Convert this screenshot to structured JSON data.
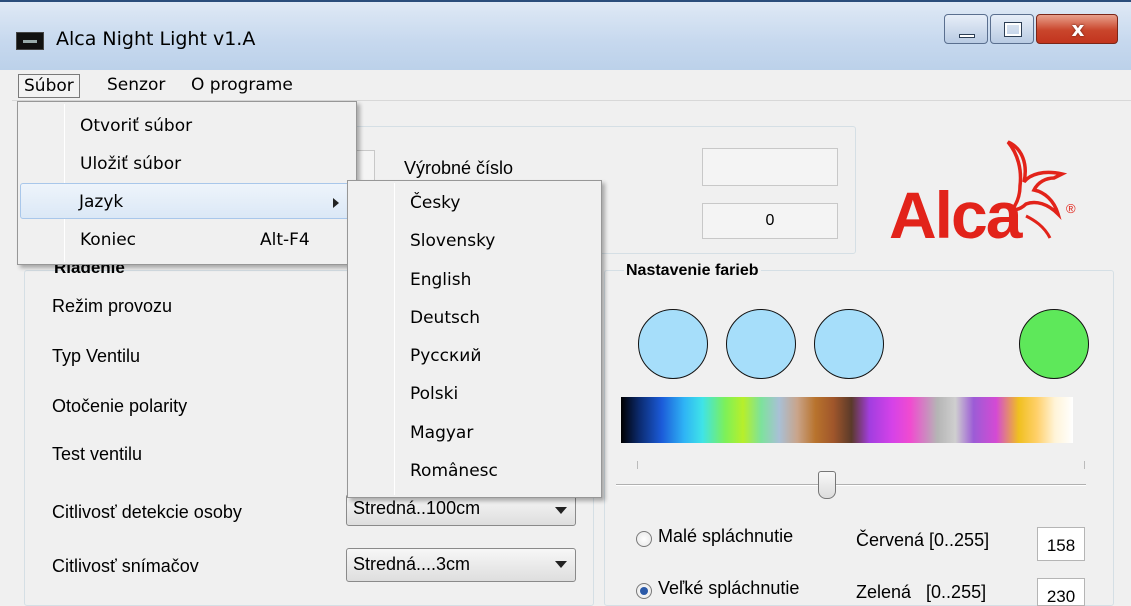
{
  "window": {
    "title": "Alca Night Light  v1.A",
    "close_glyph": "x"
  },
  "menubar": {
    "items": [
      "Súbor",
      "Senzor",
      "O programe"
    ]
  },
  "file_menu": {
    "items": [
      {
        "label": "Otvoriť súbor",
        "shortcut": ""
      },
      {
        "label": "Uložiť súbor",
        "shortcut": ""
      },
      {
        "label": "Jazyk",
        "shortcut": ""
      },
      {
        "label": "Koniec",
        "shortcut": "Alt-F4"
      }
    ]
  },
  "language_menu": {
    "items": [
      "Česky",
      "Slovensky",
      "English",
      "Deutsch",
      "Русский",
      "Polski",
      "Magyar",
      "Românesc"
    ]
  },
  "device": {
    "serial_label": "Výrobné číslo",
    "serial_value": "",
    "count_value": "0"
  },
  "logo": {
    "text": "Alca",
    "reg": "®"
  },
  "control": {
    "title": "Riadenie",
    "rows": [
      "Režim provozu",
      "Typ Ventilu",
      "Otočenie polarity",
      "Test ventilu",
      "Citlivosť detekcie osoby",
      "Citlivosť snímačov"
    ],
    "detection_value": "Stredná..100cm",
    "sensor_value": "Stredná....3cm"
  },
  "colors": {
    "title": "Nastavenie farieb",
    "circle_colors": [
      "#a6defa",
      "#a6defa",
      "#a6defa",
      "#5ee85a"
    ],
    "small_flush": "Malé spláchnutie",
    "big_flush": "Veľké spláchnutie",
    "red_label": "Červená [0..255]",
    "green_label": "Zelená   [0..255]",
    "red_value": "158",
    "green_value": "230",
    "selected_flush": "big"
  }
}
